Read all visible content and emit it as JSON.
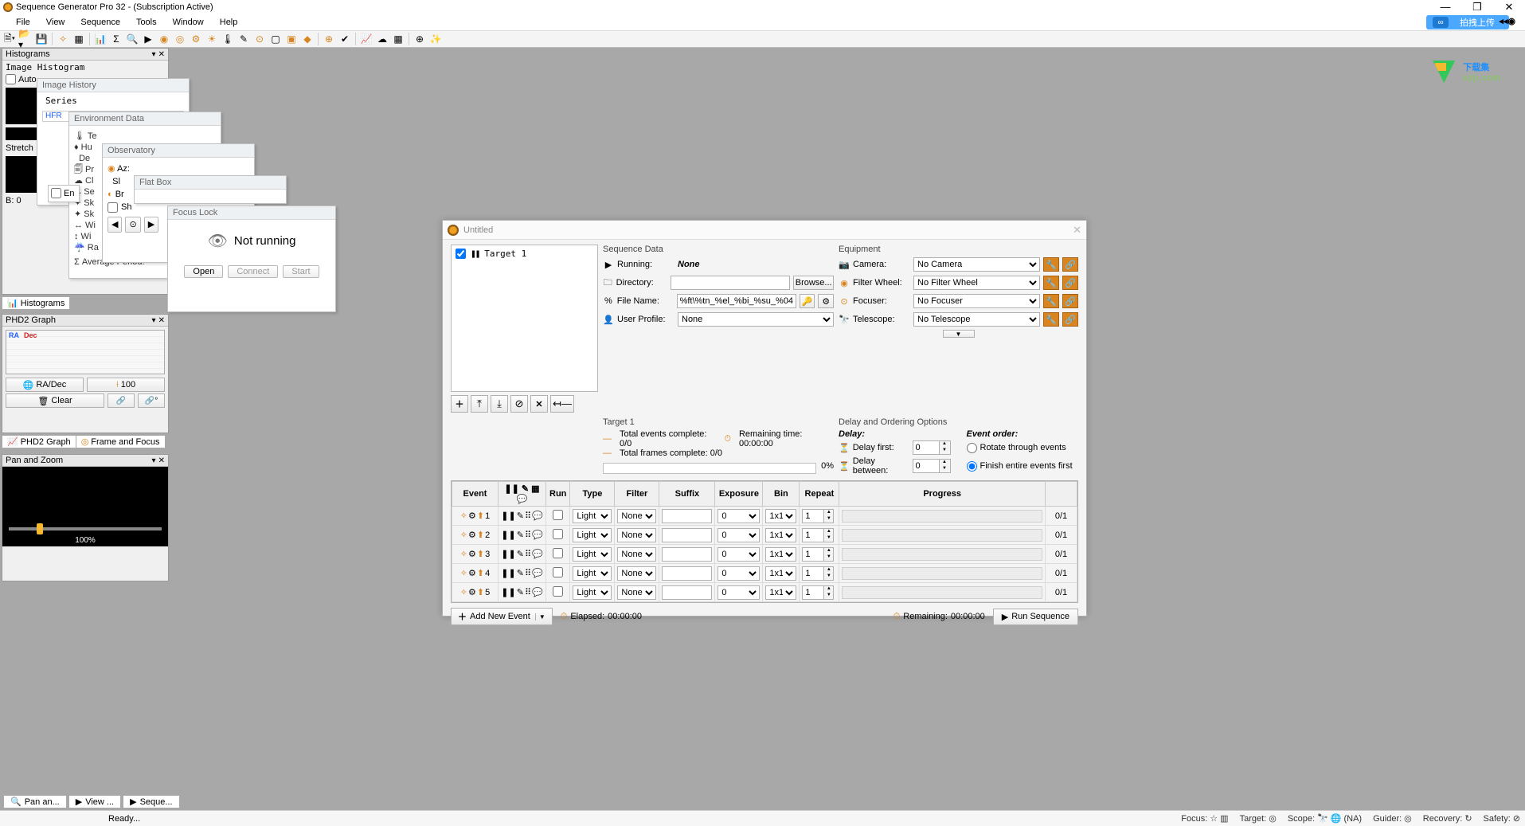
{
  "app": {
    "title": "Sequence Generator Pro 32 - (Subscription Active)",
    "pill_label": "拍拽上传",
    "pill_icon": "∞"
  },
  "menu": [
    "File",
    "View",
    "Sequence",
    "Tools",
    "Window",
    "Help"
  ],
  "watermark": {
    "main": "下载集",
    "sub": "xzji.com"
  },
  "docked": {
    "histograms": {
      "title": "Histograms",
      "subtitle": "Image Histogram",
      "auto": "Auto",
      "stretch": "Stretch",
      "b": "B: 0",
      "tab": "Histograms"
    },
    "phd2": {
      "title": "PHD2 Graph",
      "ra": "RA",
      "dec": "Dec",
      "ra_dec_btn": "RA/Dec",
      "hundred": "100",
      "clear": "Clear",
      "tab1": "PHD2 Graph",
      "tab2": "Frame and Focus"
    },
    "panzoom": {
      "title": "Pan and Zoom",
      "pct": "100%"
    }
  },
  "stacked": {
    "image_history": {
      "title": "Image History",
      "series": "Series",
      "hfr": "HFR"
    },
    "env": {
      "title": "Environment Data",
      "avg": "Σ Average Period:"
    },
    "obs": {
      "title": "Observatory",
      "az": "Az:",
      "sl": "Sl",
      "br": "Br",
      "sh": "Sh"
    },
    "flat": {
      "title": "Flat Box"
    },
    "focus": {
      "title": "Focus Lock",
      "status": "Not running",
      "open": "Open",
      "connect": "Connect",
      "start": "Start"
    }
  },
  "bottomtabs": {
    "pan": "Pan an...",
    "view": "View ...",
    "seq": "Seque..."
  },
  "status": {
    "ready": "Ready...",
    "focus": "Focus:",
    "target": "Target:",
    "scope": "Scope:",
    "na": "(NA)",
    "guider": "Guider:",
    "recovery": "Recovery:",
    "safety": "Safety:"
  },
  "main": {
    "title": "Untitled",
    "target_row": "Target 1",
    "seqdata": {
      "title": "Sequence Data",
      "running": "Running:",
      "running_val": "None",
      "directory": "Directory:",
      "filename": "File Name:",
      "filename_val": "%ft\\%tn_%el_%bi_%su_%04",
      "browse": "Browse...",
      "userprofile": "User Profile:",
      "userprofile_val": "None"
    },
    "equipment": {
      "title": "Equipment",
      "camera": "Camera:",
      "camera_val": "No Camera",
      "filter": "Filter Wheel:",
      "filter_val": "No Filter Wheel",
      "focuser": "Focuser:",
      "focuser_val": "No Focuser",
      "telescope": "Telescope:",
      "telescope_val": "No Telescope"
    },
    "target": {
      "title": "Target 1",
      "complete": "Total events complete: 0/0",
      "remaining": "Remaining time: 00:00:00",
      "frames": "Total frames complete: 0/0",
      "pct": "0%"
    },
    "delay": {
      "title": "Delay and Ordering Options",
      "delay_hdr": "Delay:",
      "order_hdr": "Event order:",
      "delay_first": "Delay first:",
      "delay_between": "Delay between:",
      "d1": "0",
      "d2": "0",
      "rotate": "Rotate through events",
      "finish": "Finish entire events first"
    },
    "table": {
      "cols": [
        "Event",
        "",
        "Run",
        "Type",
        "Filter",
        "Suffix",
        "Exposure",
        "Bin",
        "Repeat",
        "Progress",
        ""
      ],
      "rows": [
        {
          "n": "1",
          "type": "Light",
          "filter": "None",
          "suffix": "",
          "exposure": "0",
          "bin": "1x1",
          "repeat": "1",
          "prog": "0/1"
        },
        {
          "n": "2",
          "type": "Light",
          "filter": "None",
          "suffix": "",
          "exposure": "0",
          "bin": "1x1",
          "repeat": "1",
          "prog": "0/1"
        },
        {
          "n": "3",
          "type": "Light",
          "filter": "None",
          "suffix": "",
          "exposure": "0",
          "bin": "1x1",
          "repeat": "1",
          "prog": "0/1"
        },
        {
          "n": "4",
          "type": "Light",
          "filter": "None",
          "suffix": "",
          "exposure": "0",
          "bin": "1x1",
          "repeat": "1",
          "prog": "0/1"
        },
        {
          "n": "5",
          "type": "Light",
          "filter": "None",
          "suffix": "",
          "exposure": "0",
          "bin": "1x1",
          "repeat": "1",
          "prog": "0/1"
        }
      ]
    },
    "bottom": {
      "add": "Add New Event",
      "elapsed": "Elapsed:",
      "elapsed_v": "00:00:00",
      "remaining": "Remaining:",
      "remaining_v": "00:00:00",
      "run": "Run Sequence"
    }
  }
}
